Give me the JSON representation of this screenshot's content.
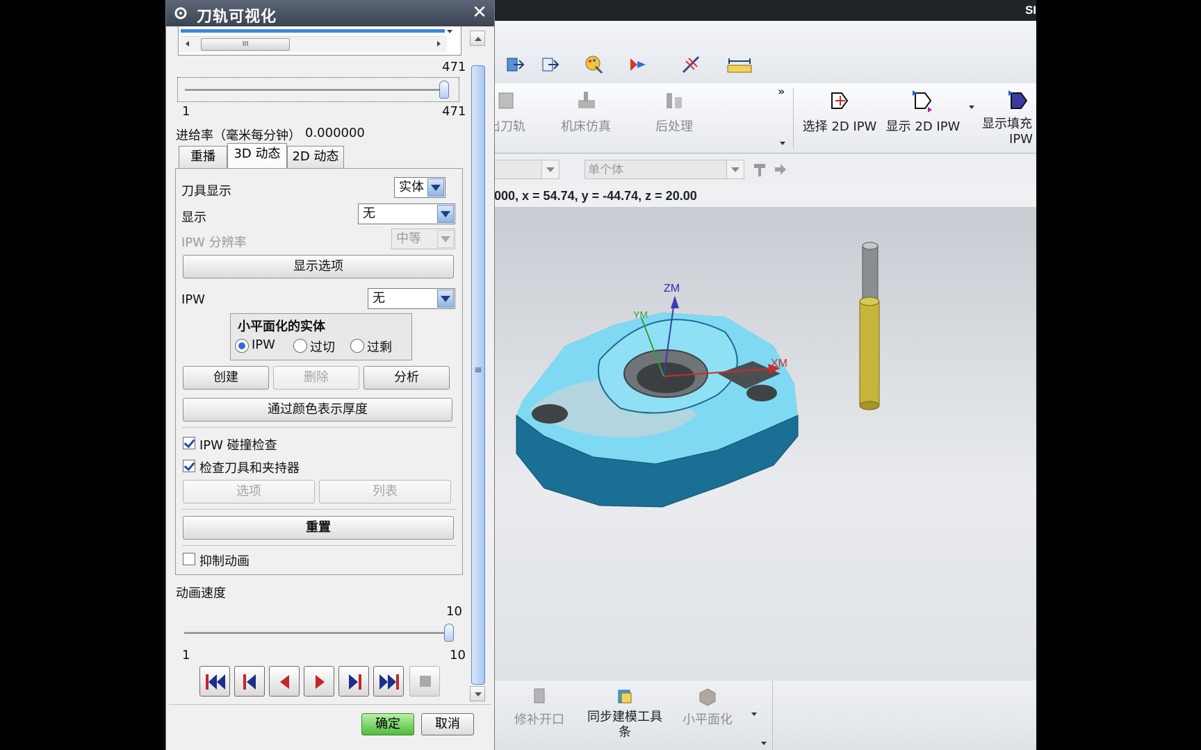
{
  "app": {
    "brand": "SI",
    "ribbon_groups": [
      {
        "label": "出刀轨",
        "enabled": false
      },
      {
        "label": "机床仿真",
        "enabled": false
      },
      {
        "label": "后处理",
        "enabled": false
      },
      {
        "label": "选择 2D IPW",
        "enabled": true
      },
      {
        "label": "显示 2D IPW",
        "enabled": true
      },
      {
        "label": "显示填充",
        "label2": "IPW",
        "enabled": true
      }
    ],
    "filter_combo_1": "",
    "filter_combo_2": "单个体",
    "coordinates": "000, x = 54.74, y = -44.74, z = 20.00",
    "axes": {
      "zm": "ZM",
      "ym": "YM",
      "xm": "XM"
    },
    "bottom_toolbar": [
      {
        "label": "修补开口",
        "enabled": false
      },
      {
        "label": "同步建模工具",
        "label2": "条",
        "enabled": true
      },
      {
        "label": "小平面化",
        "enabled": false
      }
    ],
    "colors": {
      "part_blue": "#1f7fa8",
      "part_light": "#7fd9f2",
      "tool_yellow": "#c8b43a"
    }
  },
  "dialog": {
    "title": "刀轨可视化",
    "list_scroll_glyph": "III",
    "path_slider": {
      "max_label": "471",
      "min_label": "1",
      "max_right": "471",
      "value_fraction": 1.0
    },
    "feed_rate_label": "进给率（毫米每分钟）",
    "feed_rate_value": "0.000000",
    "tabs": [
      "重播",
      "3D 动态",
      "2D 动态"
    ],
    "active_tab": "3D 动态",
    "tool_display_label": "刀具显示",
    "tool_display_value": "实体",
    "display_label": "显示",
    "display_value": "无",
    "ipw_resolution_label": "IPW 分辨率",
    "ipw_resolution_value": "中等",
    "show_options_button": "显示选项",
    "ipw_label": "IPW",
    "ipw_value": "无",
    "facet_group_title": "小平面化的实体",
    "facet_radios": [
      "IPW",
      "过切",
      "过剩"
    ],
    "facet_selected": "IPW",
    "create_button": "创建",
    "delete_button": "删除",
    "analyze_button": "分析",
    "thickness_button": "通过颜色表示厚度",
    "ipw_collision_label": "IPW 碰撞检查",
    "ipw_collision_checked": true,
    "check_tool_label": "检查刀具和夹持器",
    "check_tool_checked": true,
    "options_button": "选项",
    "list_button": "列表",
    "reset_button": "重置",
    "suppress_anim_label": "抑制动画",
    "suppress_anim_checked": false,
    "anim_speed_label": "动画速度",
    "speed_slider": {
      "max_label": "10",
      "min_label": "1",
      "max_right": "10",
      "value_fraction": 1.0
    },
    "ok_button": "确定",
    "cancel_button": "取消",
    "scroll_grip": "≡"
  }
}
